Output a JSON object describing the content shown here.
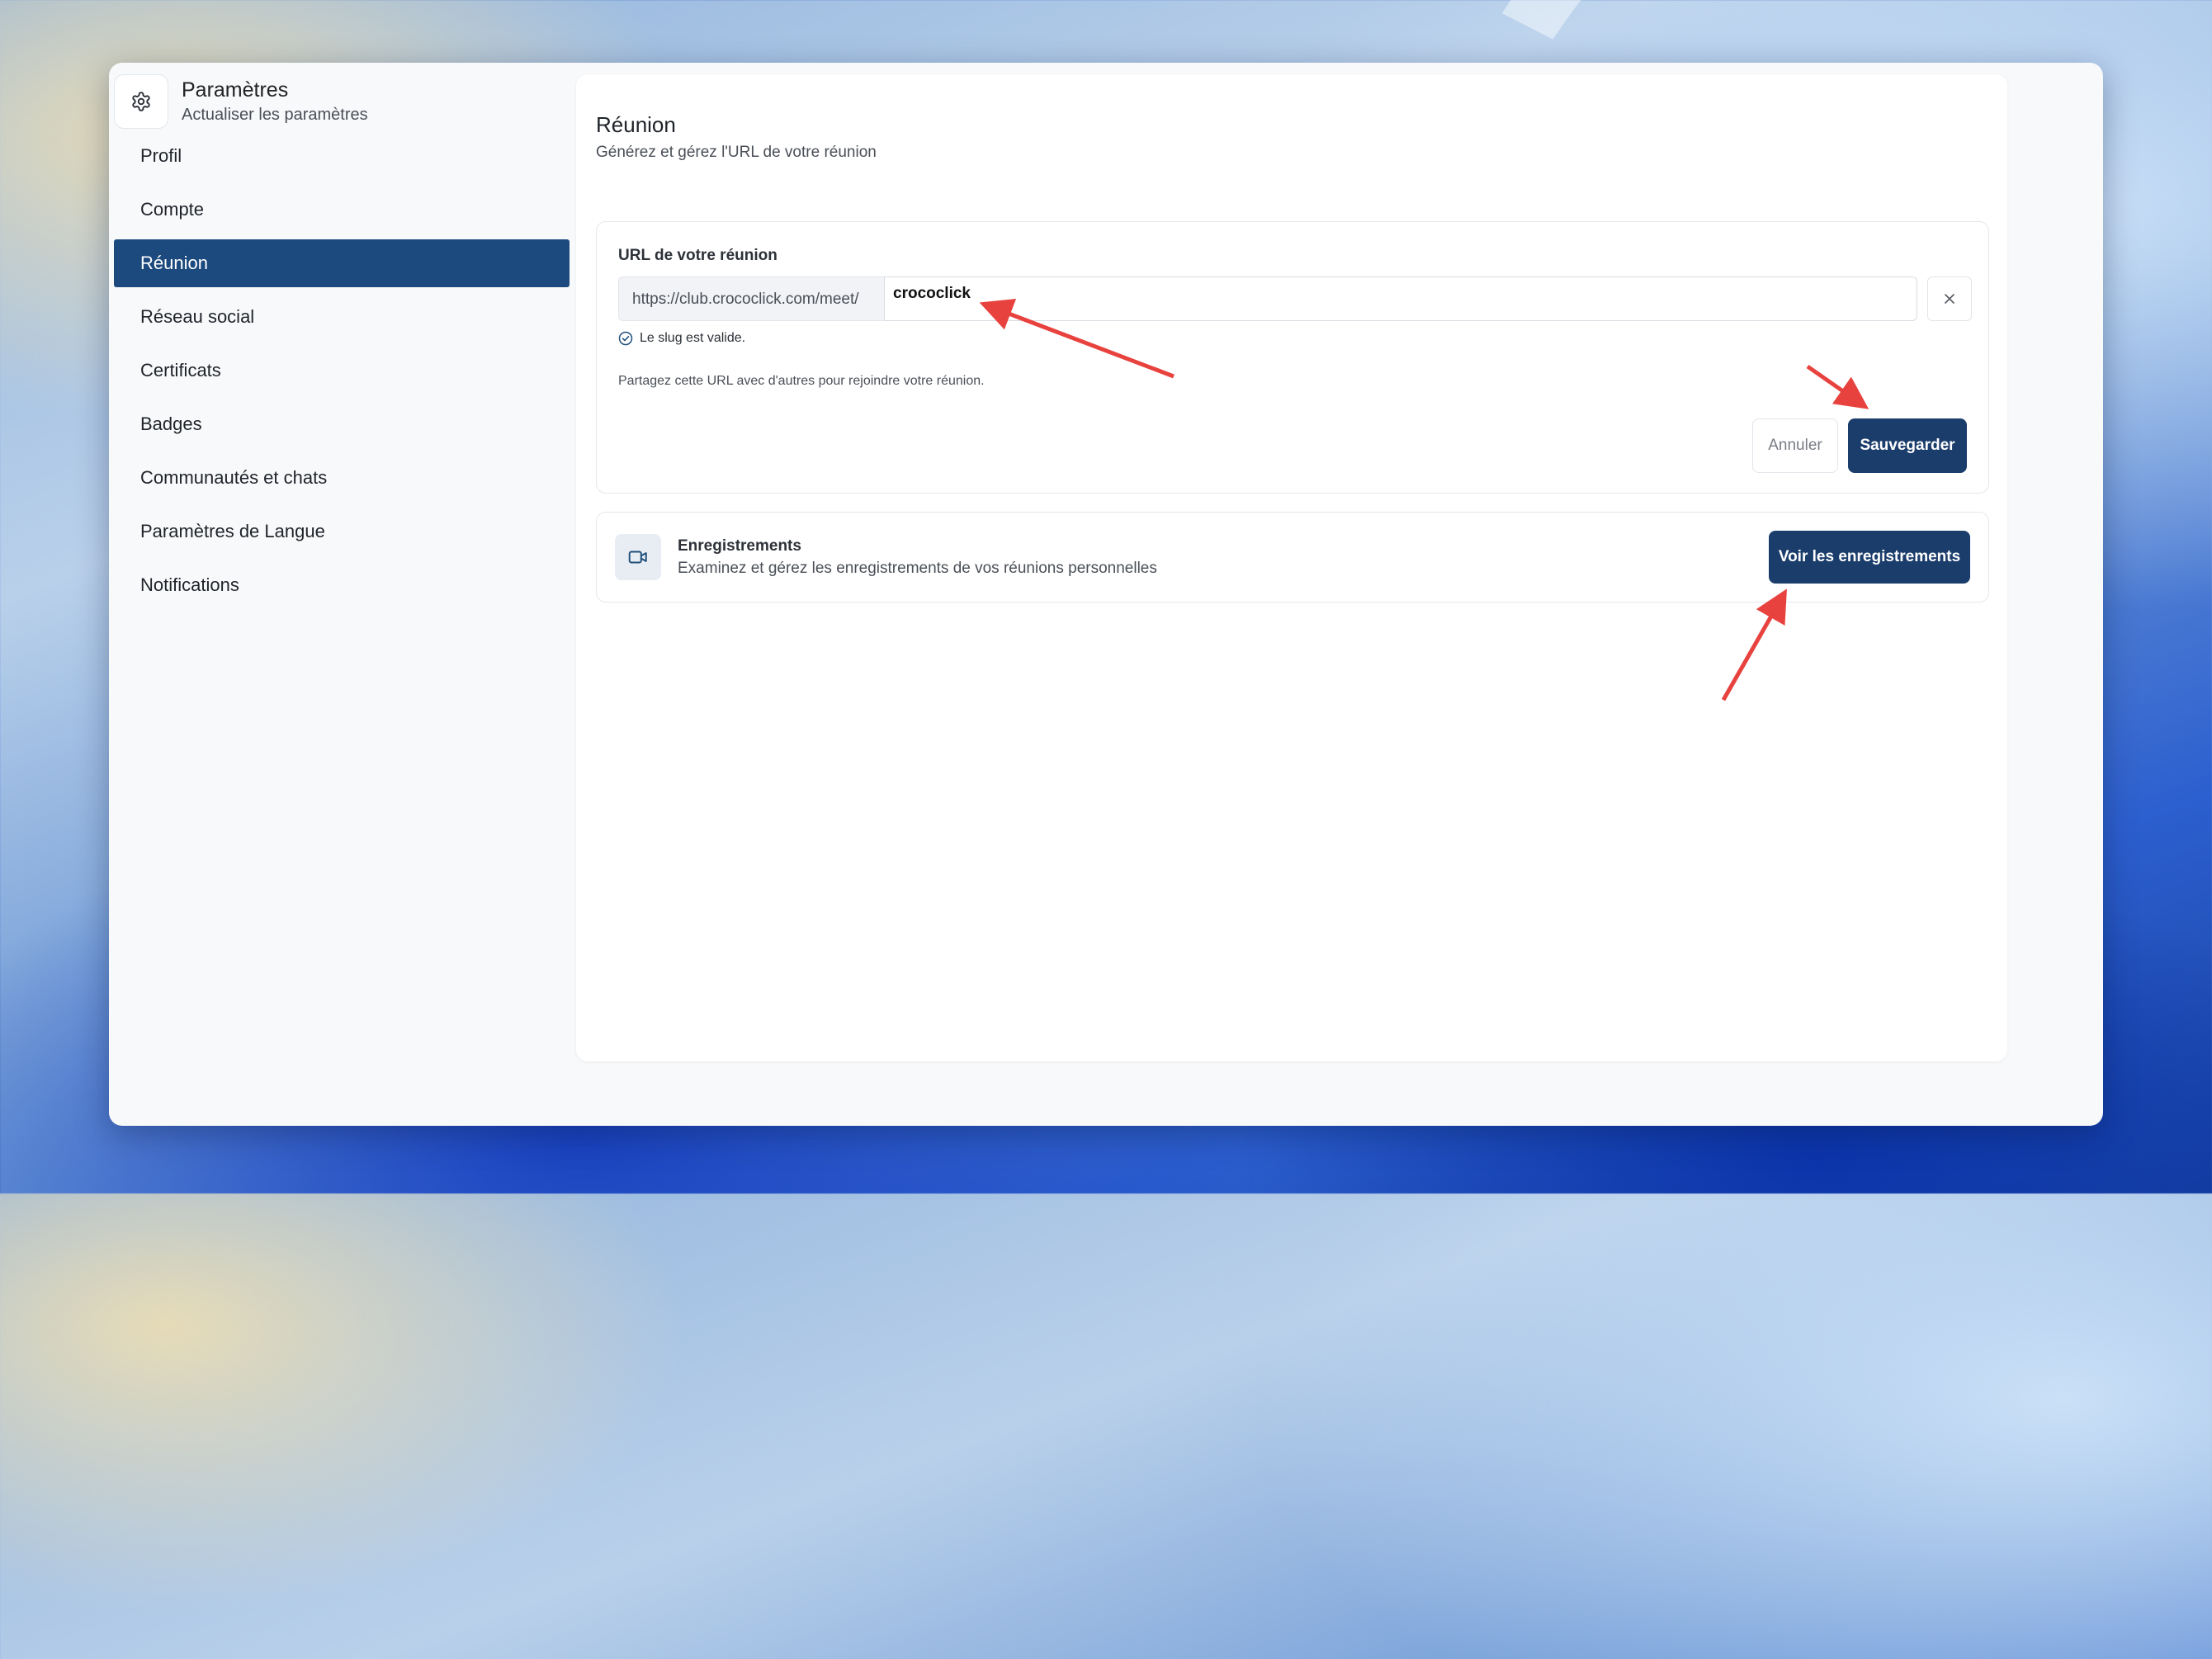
{
  "colors": {
    "accent": "#1d4a7e",
    "primary_button": "#1b3d6b",
    "annotation_arrow": "#e8423f",
    "valid": "#1f4f7a"
  },
  "sidebar": {
    "title": "Paramètres",
    "subtitle": "Actualiser les paramètres",
    "icon": "gear-icon",
    "items": [
      {
        "label": "Profil",
        "active": false
      },
      {
        "label": "Compte",
        "active": false
      },
      {
        "label": "Réunion",
        "active": true
      },
      {
        "label": "Réseau social",
        "active": false
      },
      {
        "label": "Certificats",
        "active": false
      },
      {
        "label": "Badges",
        "active": false
      },
      {
        "label": "Communautés et chats",
        "active": false
      },
      {
        "label": "Paramètres de Langue",
        "active": false
      },
      {
        "label": "Notifications",
        "active": false
      }
    ]
  },
  "main": {
    "title": "Réunion",
    "subtitle": "Générez et gérez l'URL de votre réunion",
    "url_card": {
      "label": "URL de votre réunion",
      "prefix": "https://club.crococlick.com/meet/",
      "slug_value": "crococlick",
      "valid_message": "Le slug est valide.",
      "share_hint": "Partagez cette URL avec d'autres pour rejoindre votre réunion.",
      "cancel_label": "Annuler",
      "save_label": "Sauvegarder"
    },
    "recordings_card": {
      "icon": "video-camera-icon",
      "title": "Enregistrements",
      "description": "Examinez et gérez les enregistrements de vos réunions personnelles",
      "button_label": "Voir les enregistrements"
    }
  }
}
